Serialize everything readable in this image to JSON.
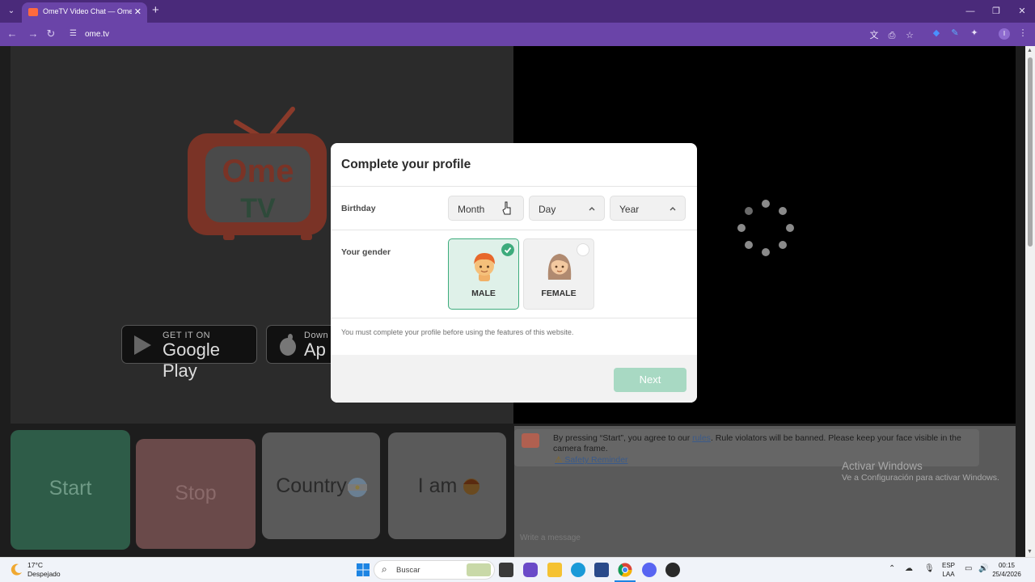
{
  "browser": {
    "tab_title": "OmeTV Video Chat — Omegle",
    "url": "ome.tv",
    "window_controls": [
      "minimize-icon",
      "restore-icon",
      "close-icon"
    ]
  },
  "page": {
    "logo_line1": "Ome",
    "logo_line2": "TV",
    "google_play": {
      "small": "GET IT ON",
      "big": "Google Play"
    },
    "app_store": {
      "small": "Down",
      "big": "Ap"
    },
    "controls": {
      "start": "Start",
      "stop": "Stop",
      "country": "Country",
      "iam": "I am"
    },
    "chat": {
      "notice_pre": "By pressing “Start”, you agree to our ",
      "notice_link": "rules",
      "notice_post": ". Rule violators will be banned. Please keep your face visible in the camera frame.",
      "safety_link": "Safety Reminder",
      "input_placeholder": "Write a message"
    }
  },
  "modal": {
    "title": "Complete your profile",
    "birthday_label": "Birthday",
    "month": "Month",
    "day": "Day",
    "year": "Year",
    "gender_label": "Your gender",
    "male_label": "MALE",
    "female_label": "FEMALE",
    "selected_gender": "MALE",
    "notice": "You must complete your profile before using the features of this website.",
    "next_label": "Next"
  },
  "windows_activation": {
    "title": "Activar Windows",
    "subtitle": "Ve a Configuración para activar Windows."
  },
  "taskbar": {
    "weather_temp": "17°C",
    "weather_desc": "Despejado",
    "search_placeholder": "Buscar",
    "lang_line1": "ESP",
    "lang_line2": "LAA",
    "time": "00:15",
    "date": "25/4/2026"
  },
  "colors": {
    "chrome_purple": "#6a44a8",
    "titlebar_purple": "#4a2a7a",
    "selected_green": "#3dab7c",
    "next_disabled": "#a8d9c3"
  }
}
